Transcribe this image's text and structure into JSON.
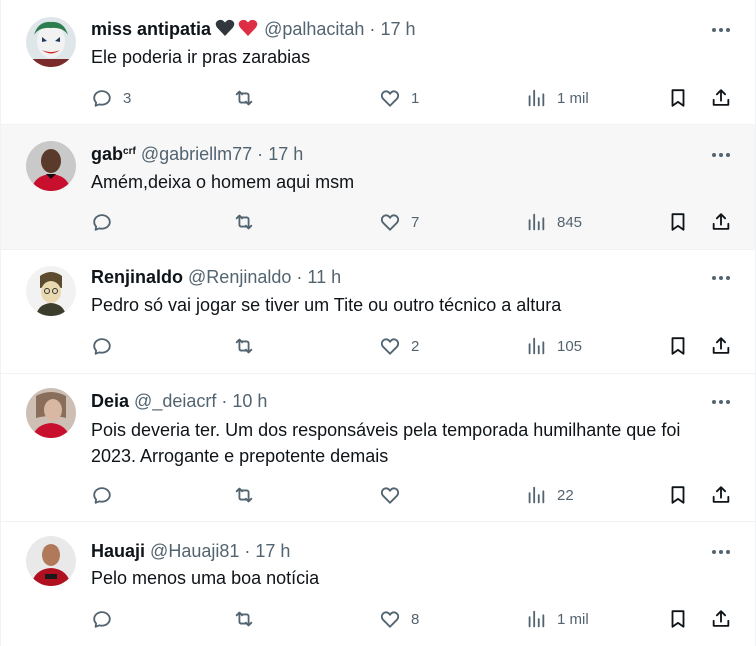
{
  "posts": [
    {
      "name": "miss antipatia",
      "name_sup": "",
      "hearts": [
        "black-heart-icon",
        "red-heart-icon"
      ],
      "handle": "@palhacitah",
      "dot": "·",
      "time": "17 h",
      "text": "Ele poderia ir pras zarabias",
      "replies": "3",
      "reposts": "",
      "likes": "1",
      "views": "1 mil"
    },
    {
      "name": "gab",
      "name_sup": "crf",
      "hearts": [],
      "handle": "@gabriellm77",
      "dot": "·",
      "time": "17 h",
      "text": "Amém,deixa o homem aqui msm",
      "replies": "",
      "reposts": "",
      "likes": "7",
      "views": "845"
    },
    {
      "name": "Renjinaldo",
      "name_sup": "",
      "hearts": [],
      "handle": "@Renjinaldo",
      "dot": "·",
      "time": "11 h",
      "text": "Pedro só vai jogar se tiver um Tite ou outro técnico a altura",
      "replies": "",
      "reposts": "",
      "likes": "2",
      "views": "105"
    },
    {
      "name": "Deia",
      "name_sup": "",
      "hearts": [],
      "handle": "@_deiacrf",
      "dot": "·",
      "time": "10 h",
      "text": "Pois deveria ter. Um dos responsáveis pela temporada humilhante que foi 2023. Arrogante e prepotente demais",
      "replies": "",
      "reposts": "",
      "likes": "",
      "views": "22"
    },
    {
      "name": "Hauaji",
      "name_sup": "",
      "hearts": [],
      "handle": "@Hauaji81",
      "dot": "·",
      "time": "17 h",
      "text": "Pelo menos uma boa notícia",
      "replies": "",
      "reposts": "",
      "likes": "8",
      "views": "1 mil"
    }
  ],
  "colors": {
    "text_primary": "#0f1419",
    "text_secondary": "#536471",
    "divider": "#eff3f4",
    "hover_bg": "#f7f7f7",
    "heart_red": "#f4212e"
  }
}
